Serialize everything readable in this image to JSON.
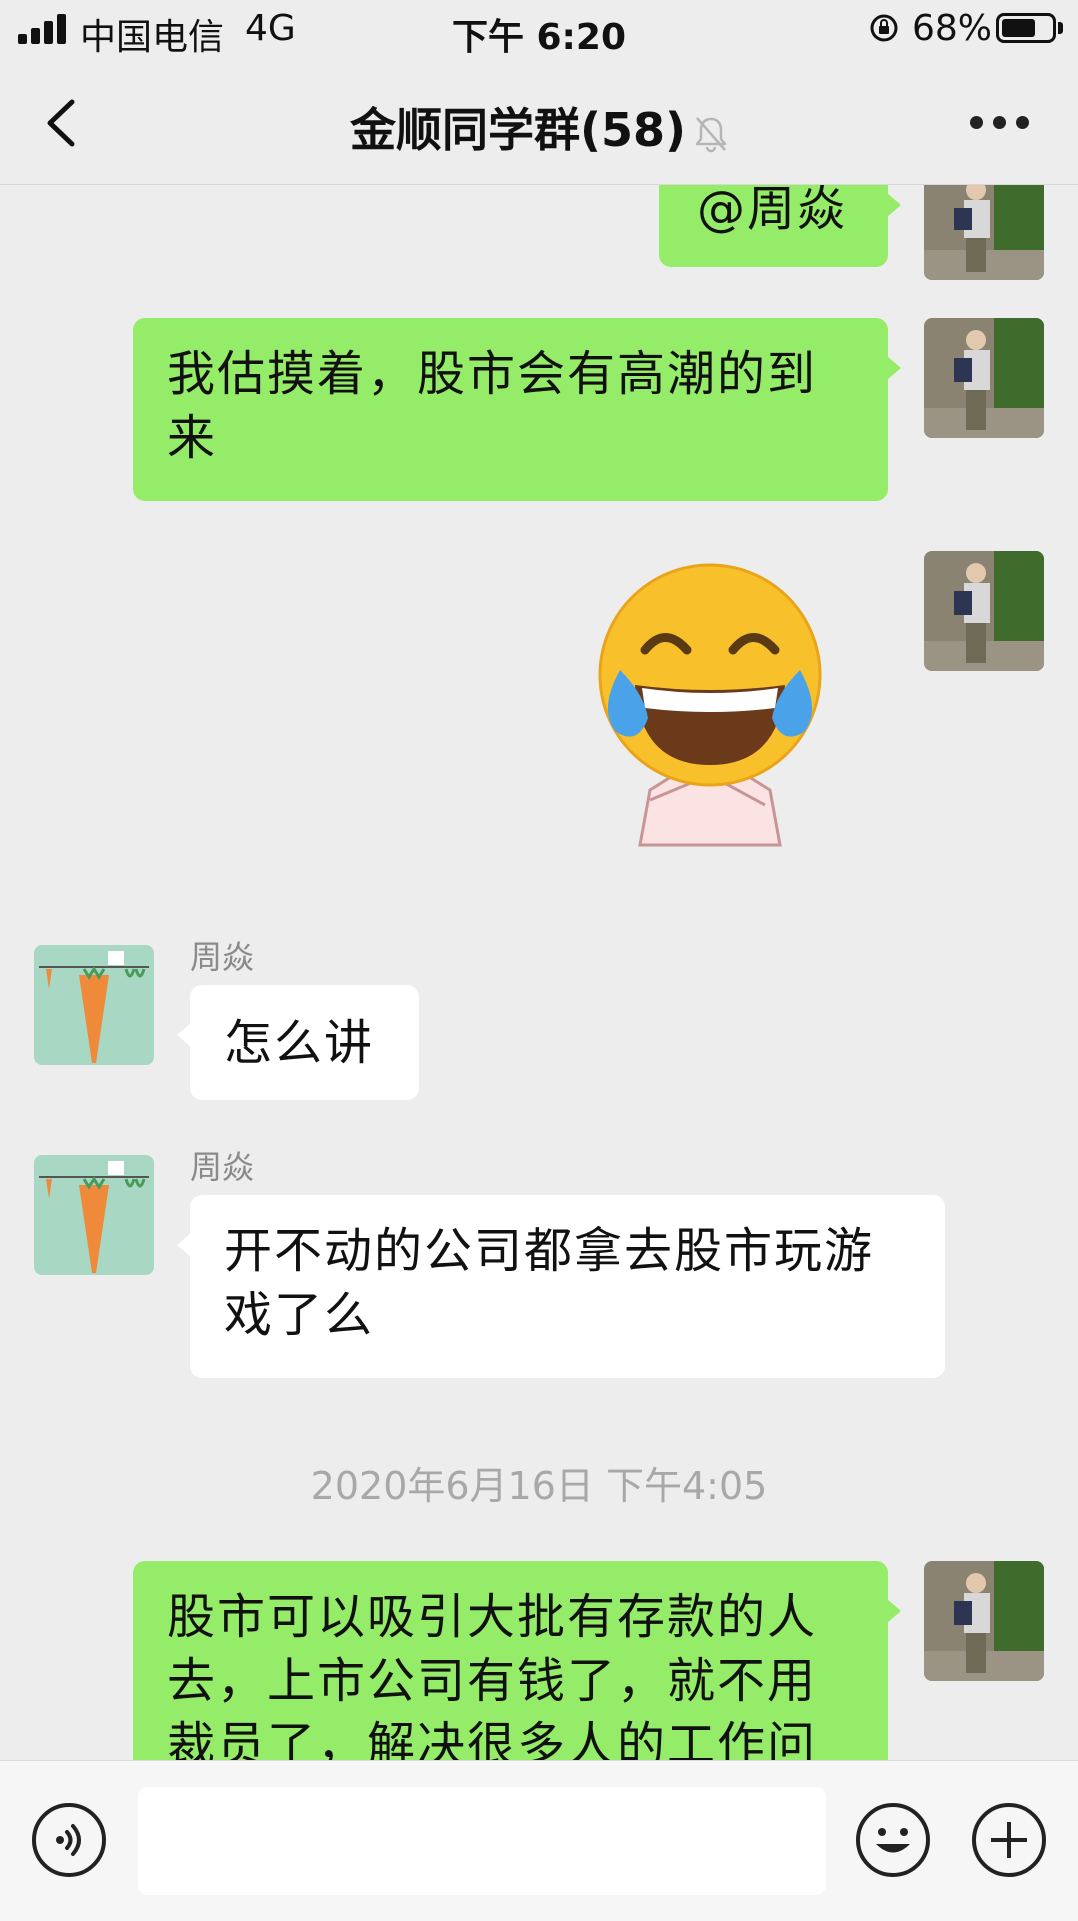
{
  "status_bar": {
    "carrier": "中国电信",
    "network": "4G",
    "time": "下午 6:20",
    "battery_percent": "68%",
    "battery_level": 0.68
  },
  "nav": {
    "title": "金顺同学群(58)",
    "icons": [
      "back-icon",
      "mute-icon",
      "more-icon"
    ]
  },
  "messages": [
    {
      "side": "right",
      "type": "text",
      "text": "@周焱"
    },
    {
      "side": "right",
      "type": "text",
      "text_lines": [
        "我估摸着，股市会有高潮的到",
        "来"
      ]
    },
    {
      "side": "right",
      "type": "sticker",
      "sticker": "laughing-tears-crossed-arms"
    },
    {
      "side": "left",
      "sender": "周焱",
      "type": "text",
      "text": "怎么讲"
    },
    {
      "side": "left",
      "sender": "周焱",
      "type": "text",
      "text_lines": [
        "开不动的公司都拿去股市玩游",
        "戏了么"
      ]
    },
    {
      "type": "timestamp",
      "text": "2020年6月16日 下午4:05"
    },
    {
      "side": "right",
      "type": "text",
      "text_lines": [
        "股市可以吸引大批有存款的人",
        "去，上市公司有钱了，就不用",
        "裁员了，解决很多人的工作问"
      ]
    }
  ],
  "input_bar": {
    "placeholder": "",
    "icons": [
      "voice-icon",
      "emoji-icon",
      "plus-icon"
    ]
  },
  "colors": {
    "background": "#ededed",
    "my_bubble": "#95ec69",
    "other_bubble": "#ffffff"
  }
}
